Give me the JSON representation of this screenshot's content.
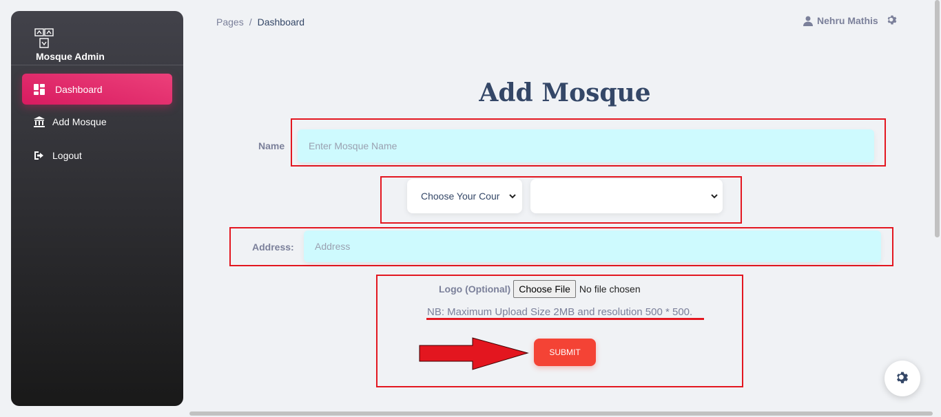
{
  "sidebar": {
    "brand": "Mosque Admin",
    "items": [
      {
        "label": "Dashboard",
        "icon": "dashboard-icon",
        "active": true
      },
      {
        "label": "Add Mosque",
        "icon": "bank-icon",
        "active": false
      },
      {
        "label": "Logout",
        "icon": "logout-icon",
        "active": false
      }
    ]
  },
  "header": {
    "breadcrumb": {
      "root": "Pages",
      "separator": "/",
      "current": "Dashboard"
    },
    "user": "Nehru Mathis"
  },
  "form": {
    "title": "Add Mosque",
    "name_label": "Name",
    "name_placeholder": "Enter Mosque Name",
    "country_select": "Choose Your Cour",
    "region_select": "",
    "address_label": "Address:",
    "address_placeholder": "Address",
    "logo_label": "Logo (Optional)",
    "file_button": "Choose File",
    "file_status": "No file chosen",
    "note": "NB: Maximum Upload Size 2MB and resolution 500 * 500.",
    "submit": "SUBMIT"
  },
  "colors": {
    "accent": "#e91e63",
    "submit": "#f44335",
    "input_bg": "#cefafe",
    "annotation": "#e3161f"
  }
}
